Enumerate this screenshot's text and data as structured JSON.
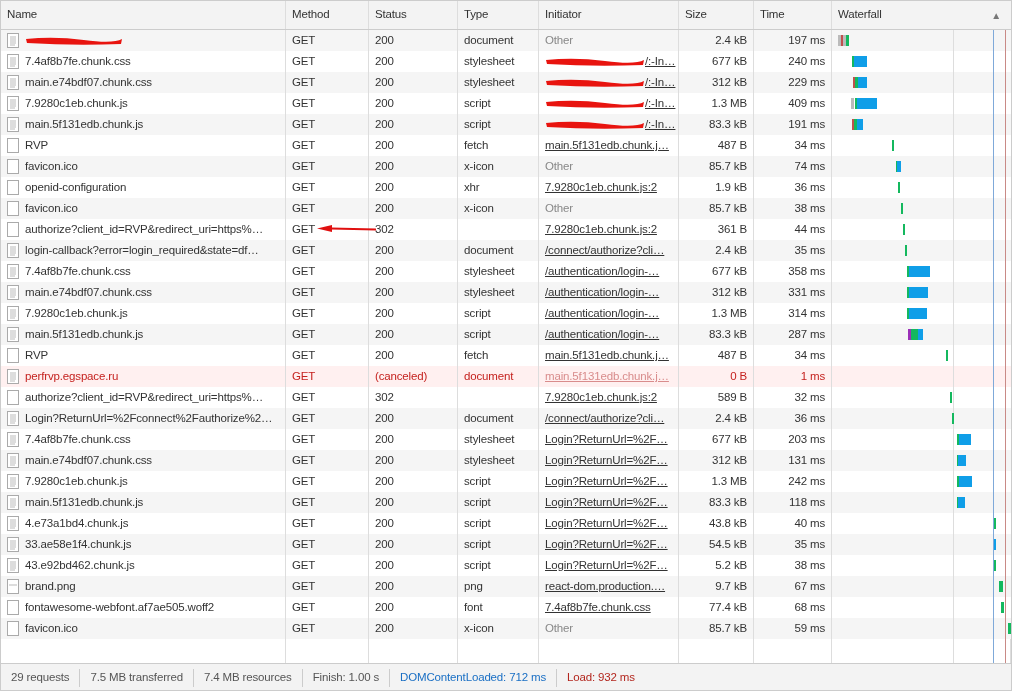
{
  "columns": [
    {
      "label": "Name"
    },
    {
      "label": "Method"
    },
    {
      "label": "Status"
    },
    {
      "label": "Type"
    },
    {
      "label": "Initiator"
    },
    {
      "label": "Size"
    },
    {
      "label": "Time"
    },
    {
      "label": "Waterfall",
      "sort_indicator": "▲"
    }
  ],
  "rows": [
    {
      "kind": "doc",
      "name_redacted": true,
      "method": "GET",
      "status": "200",
      "type": "document",
      "initiator": "Other",
      "initiator_link": false,
      "size": "2.4 kB",
      "time": "197 ms",
      "canceled": false
    },
    {
      "kind": "doc",
      "name": "7.4af8b7fe.chunk.css",
      "method": "GET",
      "status": "200",
      "type": "stylesheet",
      "initiator": "/:-In…",
      "initiator_redacted": true,
      "initiator_link": true,
      "size": "677 kB",
      "time": "240 ms",
      "canceled": false
    },
    {
      "kind": "doc",
      "name": "main.e74bdf07.chunk.css",
      "method": "GET",
      "status": "200",
      "type": "stylesheet",
      "initiator": "/:-In…",
      "initiator_redacted": true,
      "initiator_link": true,
      "size": "312 kB",
      "time": "229 ms",
      "canceled": false
    },
    {
      "kind": "doc",
      "name": "7.9280c1eb.chunk.js",
      "method": "GET",
      "status": "200",
      "type": "script",
      "initiator": "/:-In…",
      "initiator_redacted": true,
      "initiator_link": true,
      "size": "1.3 MB",
      "time": "409 ms",
      "canceled": false
    },
    {
      "kind": "doc",
      "name": "main.5f131edb.chunk.js",
      "method": "GET",
      "status": "200",
      "type": "script",
      "initiator": "/:-In…",
      "initiator_redacted": true,
      "initiator_link": true,
      "size": "83.3 kB",
      "time": "191 ms",
      "canceled": false
    },
    {
      "kind": "blank",
      "name": "RVP",
      "method": "GET",
      "status": "200",
      "type": "fetch",
      "initiator": "main.5f131edb.chunk.j…",
      "initiator_link": true,
      "size": "487 B",
      "time": "34 ms",
      "canceled": false
    },
    {
      "kind": "blank",
      "name": "favicon.ico",
      "method": "GET",
      "status": "200",
      "type": "x-icon",
      "initiator": "Other",
      "initiator_link": false,
      "size": "85.7 kB",
      "time": "74 ms",
      "canceled": false
    },
    {
      "kind": "blank",
      "name": "openid-configuration",
      "method": "GET",
      "status": "200",
      "type": "xhr",
      "initiator": "7.9280c1eb.chunk.js:2",
      "initiator_link": true,
      "size": "1.9 kB",
      "time": "36 ms",
      "canceled": false
    },
    {
      "kind": "blank",
      "name": "favicon.ico",
      "method": "GET",
      "status": "200",
      "type": "x-icon",
      "initiator": "Other",
      "initiator_link": false,
      "size": "85.7 kB",
      "time": "38 ms",
      "canceled": false
    },
    {
      "kind": "blank",
      "name": "authorize?client_id=RVP&redirect_uri=https%…",
      "method": "GET",
      "status": "302",
      "initiator": "7.9280c1eb.chunk.js:2",
      "initiator_link": true,
      "size": "361 B",
      "time": "44 ms",
      "canceled": false,
      "arrow_annotation": true
    },
    {
      "kind": "doc",
      "name": "login-callback?error=login_required&state=df…",
      "method": "GET",
      "status": "200",
      "type": "document",
      "initiator": "/connect/authorize?cli…",
      "initiator_link": true,
      "size": "2.4 kB",
      "time": "35 ms",
      "canceled": false
    },
    {
      "kind": "doc",
      "name": "7.4af8b7fe.chunk.css",
      "method": "GET",
      "status": "200",
      "type": "stylesheet",
      "initiator": "/authentication/login-…",
      "initiator_link": true,
      "size": "677 kB",
      "time": "358 ms",
      "canceled": false
    },
    {
      "kind": "doc",
      "name": "main.e74bdf07.chunk.css",
      "method": "GET",
      "status": "200",
      "type": "stylesheet",
      "initiator": "/authentication/login-…",
      "initiator_link": true,
      "size": "312 kB",
      "time": "331 ms",
      "canceled": false
    },
    {
      "kind": "doc",
      "name": "7.9280c1eb.chunk.js",
      "method": "GET",
      "status": "200",
      "type": "script",
      "initiator": "/authentication/login-…",
      "initiator_link": true,
      "size": "1.3 MB",
      "time": "314 ms",
      "canceled": false
    },
    {
      "kind": "doc",
      "name": "main.5f131edb.chunk.js",
      "method": "GET",
      "status": "200",
      "type": "script",
      "initiator": "/authentication/login-…",
      "initiator_link": true,
      "size": "83.3 kB",
      "time": "287 ms",
      "canceled": false
    },
    {
      "kind": "blank",
      "name": "RVP",
      "method": "GET",
      "status": "200",
      "type": "fetch",
      "initiator": "main.5f131edb.chunk.j…",
      "initiator_link": true,
      "size": "487 B",
      "time": "34 ms",
      "canceled": false
    },
    {
      "kind": "doc",
      "name": "perfrvp.egspace.ru",
      "method": "GET",
      "status": "(canceled)",
      "type": "document",
      "initiator": "main.5f131edb.chunk.j…",
      "initiator_link": true,
      "size": "0 B",
      "time": "1 ms",
      "canceled": true
    },
    {
      "kind": "blank",
      "name": "authorize?client_id=RVP&redirect_uri=https%…",
      "method": "GET",
      "status": "302",
      "initiator": "7.9280c1eb.chunk.js:2",
      "initiator_link": true,
      "size": "589 B",
      "time": "32 ms",
      "canceled": false
    },
    {
      "kind": "doc",
      "name": "Login?ReturnUrl=%2Fconnect%2Fauthorize%2…",
      "method": "GET",
      "status": "200",
      "type": "document",
      "initiator": "/connect/authorize?cli…",
      "initiator_link": true,
      "size": "2.4 kB",
      "time": "36 ms",
      "canceled": false
    },
    {
      "kind": "doc",
      "name": "7.4af8b7fe.chunk.css",
      "method": "GET",
      "status": "200",
      "type": "stylesheet",
      "initiator": "Login?ReturnUrl=%2F…",
      "initiator_link": true,
      "size": "677 kB",
      "time": "203 ms",
      "canceled": false
    },
    {
      "kind": "doc",
      "name": "main.e74bdf07.chunk.css",
      "method": "GET",
      "status": "200",
      "type": "stylesheet",
      "initiator": "Login?ReturnUrl=%2F…",
      "initiator_link": true,
      "size": "312 kB",
      "time": "131 ms",
      "canceled": false
    },
    {
      "kind": "doc",
      "name": "7.9280c1eb.chunk.js",
      "method": "GET",
      "status": "200",
      "type": "script",
      "initiator": "Login?ReturnUrl=%2F…",
      "initiator_link": true,
      "size": "1.3 MB",
      "time": "242 ms",
      "canceled": false
    },
    {
      "kind": "doc",
      "name": "main.5f131edb.chunk.js",
      "method": "GET",
      "status": "200",
      "type": "script",
      "initiator": "Login?ReturnUrl=%2F…",
      "initiator_link": true,
      "size": "83.3 kB",
      "time": "118 ms",
      "canceled": false
    },
    {
      "kind": "doc",
      "name": "4.e73a1bd4.chunk.js",
      "method": "GET",
      "status": "200",
      "type": "script",
      "initiator": "Login?ReturnUrl=%2F…",
      "initiator_link": true,
      "size": "43.8 kB",
      "time": "40 ms",
      "canceled": false
    },
    {
      "kind": "doc",
      "name": "33.ae58e1f4.chunk.js",
      "method": "GET",
      "status": "200",
      "type": "script",
      "initiator": "Login?ReturnUrl=%2F…",
      "initiator_link": true,
      "size": "54.5 kB",
      "time": "35 ms",
      "canceled": false
    },
    {
      "kind": "doc",
      "name": "43.e92bd462.chunk.js",
      "method": "GET",
      "status": "200",
      "type": "script",
      "initiator": "Login?ReturnUrl=%2F…",
      "initiator_link": true,
      "size": "5.2 kB",
      "time": "38 ms",
      "canceled": false
    },
    {
      "kind": "image",
      "name": "brand.png",
      "method": "GET",
      "status": "200",
      "type": "png",
      "initiator": "react-dom.production.…",
      "initiator_link": true,
      "size": "9.7 kB",
      "time": "67 ms",
      "canceled": false
    },
    {
      "kind": "blank",
      "name": "fontawesome-webfont.af7ae505.woff2",
      "method": "GET",
      "status": "200",
      "type": "font",
      "initiator": "7.4af8b7fe.chunk.css",
      "initiator_link": true,
      "size": "77.4 kB",
      "time": "68 ms",
      "canceled": false
    },
    {
      "kind": "blank",
      "name": "favicon.ico",
      "method": "GET",
      "status": "200",
      "type": "x-icon",
      "initiator": "Other",
      "initiator_link": false,
      "size": "85.7 kB",
      "time": "59 ms",
      "canceled": false
    }
  ],
  "status_bar": [
    {
      "text": "29 requests",
      "kind": "plain"
    },
    {
      "text": "7.5 MB transferred",
      "kind": "plain"
    },
    {
      "text": "7.4 MB resources",
      "kind": "plain"
    },
    {
      "text": "Finish: 1.00 s",
      "kind": "plain"
    },
    {
      "text": "DOMContentLoaded: 712 ms",
      "kind": "dcl"
    },
    {
      "text": "Load: 932 ms",
      "kind": "load"
    }
  ]
}
